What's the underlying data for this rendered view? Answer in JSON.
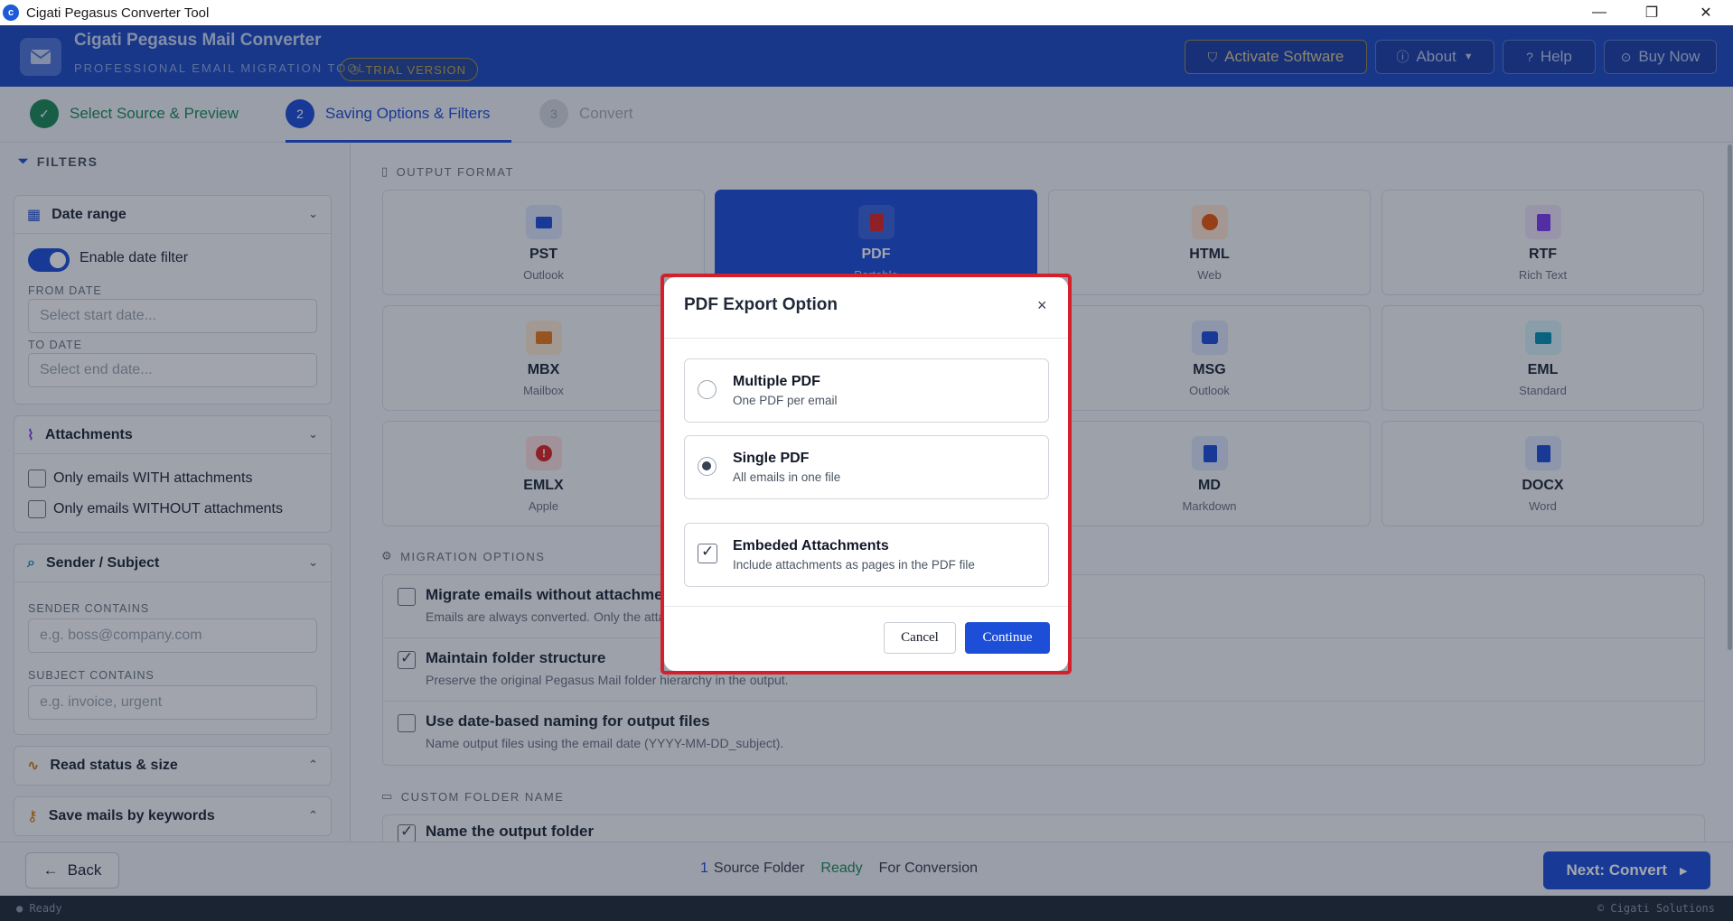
{
  "window": {
    "title": "Cigati Pegasus Converter Tool",
    "controls": [
      "—",
      "❐",
      "✕"
    ]
  },
  "header": {
    "title": "Cigati Pegasus Mail Converter",
    "subtitle": "PROFESSIONAL EMAIL MIGRATION TOOL",
    "badge": "TRIAL VERSION",
    "buttons": {
      "activate": "Activate Software",
      "about": "About",
      "help": "Help",
      "buy": "Buy Now"
    }
  },
  "steps": [
    {
      "num": "✓",
      "label": "Select Source & Preview",
      "state": "done"
    },
    {
      "num": "2",
      "label": "Saving Options & Filters",
      "state": "active"
    },
    {
      "num": "3",
      "label": "Convert",
      "state": "pending"
    }
  ],
  "sidebar": {
    "title": "FILTERS",
    "date_range": {
      "title": "Date range",
      "toggle_label": "Enable date filter",
      "toggle_on": true,
      "from_label": "FROM DATE",
      "from_placeholder": "Select start date...",
      "to_label": "TO DATE",
      "to_placeholder": "Select end date..."
    },
    "attachments": {
      "title": "Attachments",
      "with": "Only emails WITH attachments",
      "without": "Only emails WITHOUT attachments"
    },
    "sender_subject": {
      "title": "Sender / Subject",
      "sender_label": "SENDER CONTAINS",
      "sender_placeholder": "e.g. boss@company.com",
      "subject_label": "SUBJECT CONTAINS",
      "subject_placeholder": "e.g. invoice, urgent"
    },
    "read_status": {
      "title": "Read status & size"
    },
    "keywords": {
      "title": "Save mails by keywords"
    }
  },
  "main": {
    "output_format_label": "OUTPUT FORMAT",
    "formats": [
      {
        "name": "PST",
        "sub": "Outlook",
        "color": "#1d4ed8",
        "selected": false
      },
      {
        "name": "PDF",
        "sub": "Portable",
        "color": "#dc2626",
        "selected": true
      },
      {
        "name": "HTML",
        "sub": "Web",
        "color": "#ea580c",
        "selected": false
      },
      {
        "name": "RTF",
        "sub": "Rich Text",
        "color": "#7c3aed",
        "selected": false
      },
      {
        "name": "MBX",
        "sub": "Mailbox",
        "color": "#ea7a1a",
        "selected": false
      },
      {
        "name": "MSG",
        "sub": "Outlook",
        "color": "#1d4ed8",
        "selected": false
      },
      {
        "name": "EML",
        "sub": "Standard",
        "color": "#0891b2",
        "selected": false
      },
      {
        "name": "EMLX",
        "sub": "Apple",
        "color": "#dc2626",
        "selected": false
      },
      {
        "name": "MD",
        "sub": "Markdown",
        "color": "#1d4ed8",
        "selected": false
      },
      {
        "name": "DOCX",
        "sub": "Word",
        "color": "#1d4ed8",
        "selected": false
      }
    ],
    "migration_label": "MIGRATION OPTIONS",
    "migration": [
      {
        "title": "Migrate emails without attachments",
        "desc": "Emails are always converted. Only the attachments are skipped.",
        "checked": false
      },
      {
        "title": "Maintain folder structure",
        "desc": "Preserve the original Pegasus Mail folder hierarchy in the output.",
        "checked": true
      },
      {
        "title": "Use date-based naming for output files",
        "desc": "Name output files using the email date (YYYY-MM-DD_subject).",
        "checked": false
      }
    ],
    "custom_folder_label": "CUSTOM FOLDER NAME",
    "name_output": "Name the output folder"
  },
  "bottom": {
    "back": "Back",
    "count": "1",
    "source_text": "Source Folder",
    "ready": "Ready",
    "for_conversion": "For Conversion",
    "next": "Next: Convert"
  },
  "statusbar": {
    "left": "● Ready",
    "right": "© Cigati Solutions"
  },
  "modal": {
    "title": "PDF Export Option",
    "close": "×",
    "options": [
      {
        "title": "Multiple PDF",
        "desc": "One PDF per email",
        "selected": false
      },
      {
        "title": "Single PDF",
        "desc": "All emails in one file",
        "selected": true
      }
    ],
    "embed": {
      "title": "Embeded Attachments",
      "desc": "Include attachments as pages in the PDF file",
      "checked": true
    },
    "cancel": "Cancel",
    "continue": "Continue"
  }
}
